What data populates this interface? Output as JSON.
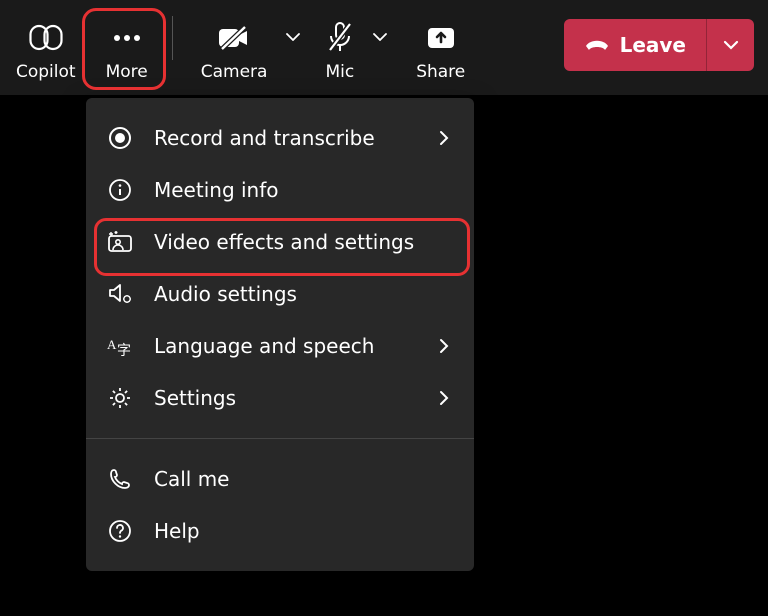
{
  "toolbar": {
    "copilot_label": "Copilot",
    "more_label": "More",
    "camera_label": "Camera",
    "mic_label": "Mic",
    "share_label": "Share",
    "leave_label": "Leave"
  },
  "menu": {
    "items": [
      {
        "label": "Record and transcribe",
        "has_sub": true,
        "icon": "record"
      },
      {
        "label": "Meeting info",
        "has_sub": false,
        "icon": "info"
      },
      {
        "label": "Video effects and settings",
        "has_sub": false,
        "icon": "video-effects"
      },
      {
        "label": "Audio settings",
        "has_sub": false,
        "icon": "audio"
      },
      {
        "label": "Language and speech",
        "has_sub": true,
        "icon": "language"
      },
      {
        "label": "Settings",
        "has_sub": true,
        "icon": "gear"
      }
    ],
    "secondary": [
      {
        "label": "Call me",
        "icon": "phone"
      },
      {
        "label": "Help",
        "icon": "help"
      }
    ]
  }
}
